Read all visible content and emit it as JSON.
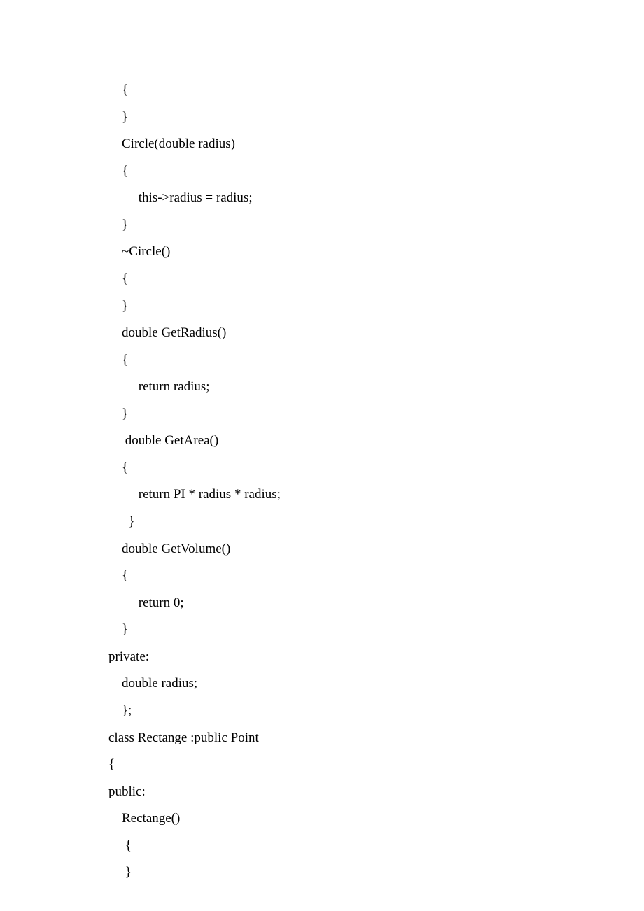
{
  "lines": [
    "    {",
    "    }",
    "    Circle(double radius)",
    "    {",
    "         this->radius = radius;",
    "    }",
    "    ~Circle()",
    "    {",
    "    }",
    "    double GetRadius()",
    "    {",
    "         return radius;",
    "    }",
    "     double GetArea()",
    "    {",
    "         return PI * radius * radius;",
    "      }",
    "    double GetVolume()",
    "    {",
    "         return 0;",
    "    }",
    "private:",
    "    double radius;",
    "    };",
    "class Rectange :public Point",
    "{",
    "public:",
    "    Rectange()",
    "     {",
    "     }"
  ]
}
